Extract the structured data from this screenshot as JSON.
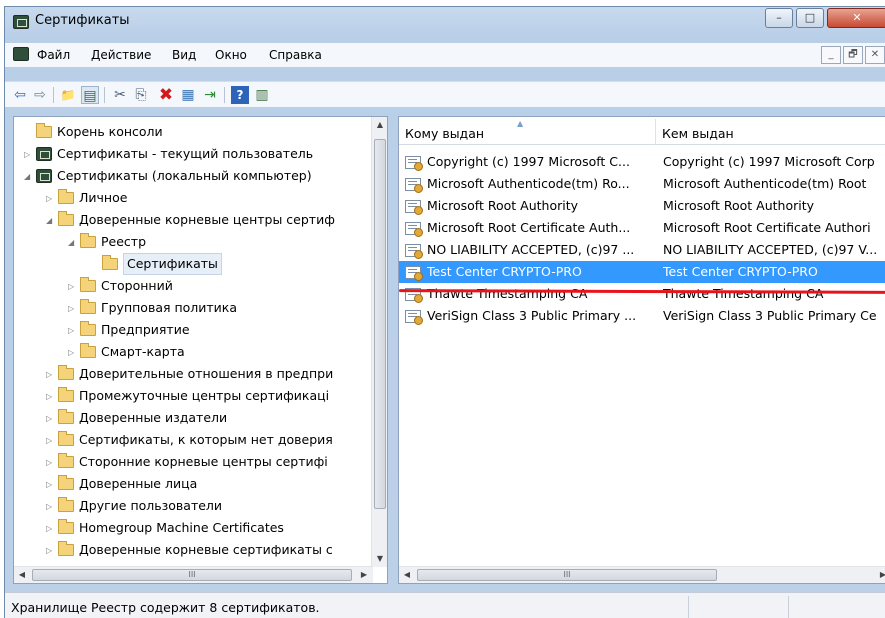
{
  "window": {
    "title": "Сертификаты",
    "buttons": {
      "minimize": "–",
      "maximize": "□",
      "close": "✕"
    }
  },
  "menu": {
    "items": [
      "Файл",
      "Действие",
      "Вид",
      "Окно",
      "Справка"
    ],
    "mdi_min": "_",
    "mdi_restore": "🗗",
    "mdi_close": "✕"
  },
  "toolbar": {
    "back": "⇦",
    "forward": "⇨",
    "up": "📁",
    "show_tree": "▤",
    "cut": "✂",
    "copy": "⎘",
    "delete": "✖",
    "properties": "▦",
    "export": "⇥",
    "help": "?",
    "details": "▥"
  },
  "tree": {
    "items": [
      {
        "label": "Корень консоли",
        "kind": "folder",
        "level": 0,
        "expander": ""
      },
      {
        "label": "Сертификаты - текущий пользователь",
        "kind": "certroot",
        "level": 0,
        "expander": "▷"
      },
      {
        "label": "Сертификаты (локальный компьютер)",
        "kind": "certroot",
        "level": 0,
        "expander": "◢"
      },
      {
        "label": "Личное",
        "kind": "folder",
        "level": 1,
        "expander": "▷"
      },
      {
        "label": "Доверенные корневые центры сертиф",
        "kind": "folder",
        "level": 1,
        "expander": "◢"
      },
      {
        "label": "Реестр",
        "kind": "folder",
        "level": 2,
        "expander": "◢"
      },
      {
        "label": "Сертификаты",
        "kind": "folder",
        "level": 3,
        "expander": "",
        "selected": true
      },
      {
        "label": "Сторонний",
        "kind": "folder",
        "level": 2,
        "expander": "▷"
      },
      {
        "label": "Групповая политика",
        "kind": "folder",
        "level": 2,
        "expander": "▷"
      },
      {
        "label": "Предприятие",
        "kind": "folder",
        "level": 2,
        "expander": "▷"
      },
      {
        "label": "Смарт-карта",
        "kind": "folder",
        "level": 2,
        "expander": "▷"
      },
      {
        "label": "Доверительные отношения в предпри",
        "kind": "folder",
        "level": 1,
        "expander": "▷"
      },
      {
        "label": "Промежуточные центры сертификаці",
        "kind": "folder",
        "level": 1,
        "expander": "▷"
      },
      {
        "label": "Доверенные издатели",
        "kind": "folder",
        "level": 1,
        "expander": "▷"
      },
      {
        "label": "Сертификаты, к которым нет доверия",
        "kind": "folder",
        "level": 1,
        "expander": "▷"
      },
      {
        "label": "Сторонние корневые центры сертифі",
        "kind": "folder",
        "level": 1,
        "expander": "▷"
      },
      {
        "label": "Доверенные лица",
        "kind": "folder",
        "level": 1,
        "expander": "▷"
      },
      {
        "label": "Другие пользователи",
        "kind": "folder",
        "level": 1,
        "expander": "▷"
      },
      {
        "label": "Homegroup Machine Certificates",
        "kind": "folder",
        "level": 1,
        "expander": "▷"
      },
      {
        "label": "Доверенные корневые сертификаты с",
        "kind": "folder",
        "level": 1,
        "expander": "▷"
      }
    ],
    "hscroll_thumb": "III"
  },
  "list": {
    "columns": [
      "Кому выдан",
      "Кем выдан"
    ],
    "sort_indicator": "▲",
    "rows": [
      {
        "issued_to": "Copyright (c) 1997 Microsoft C...",
        "issued_by": "Copyright (c) 1997 Microsoft Corp"
      },
      {
        "issued_to": "Microsoft Authenticode(tm) Ro...",
        "issued_by": "Microsoft Authenticode(tm) Root"
      },
      {
        "issued_to": "Microsoft Root Authority",
        "issued_by": "Microsoft Root Authority"
      },
      {
        "issued_to": "Microsoft Root Certificate Auth...",
        "issued_by": "Microsoft Root Certificate Authori"
      },
      {
        "issued_to": "NO LIABILITY ACCEPTED, (c)97 ...",
        "issued_by": "NO LIABILITY ACCEPTED, (c)97 V..."
      },
      {
        "issued_to": "Test Center CRYPTO-PRO",
        "issued_by": "Test Center CRYPTO-PRO",
        "selected": true
      },
      {
        "issued_to": "Thawte Timestamping CA",
        "issued_by": "Thawte Timestamping CA"
      },
      {
        "issued_to": "VeriSign Class 3 Public Primary ...",
        "issued_by": "VeriSign Class 3 Public Primary Ce"
      }
    ],
    "hscroll_thumb": "III"
  },
  "status": {
    "text": "Хранилище Реестр содержит 8 сертификатов."
  },
  "colors": {
    "selection": "#3399ff",
    "highlight_underline": "#e8141c"
  }
}
